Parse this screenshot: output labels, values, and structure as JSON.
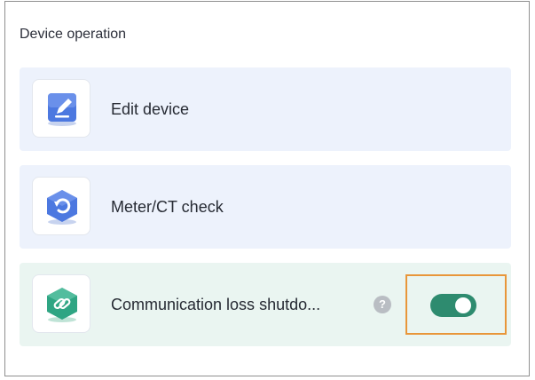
{
  "section": {
    "title": "Device operation"
  },
  "items": [
    {
      "label": "Edit device",
      "icon": "edit-icon"
    },
    {
      "label": "Meter/CT check",
      "icon": "refresh-hexagon-icon"
    },
    {
      "label": "Communication loss shutdo...",
      "icon": "link-hexagon-icon",
      "help": "?",
      "toggle_on": true
    }
  ],
  "colors": {
    "accent_green": "#2e8b6f",
    "highlight_orange": "#e8963a",
    "card_blue": "#edf2fc",
    "card_green": "#eaf5f1"
  }
}
